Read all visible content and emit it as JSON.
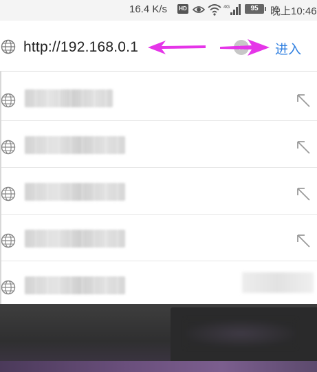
{
  "status_bar": {
    "net_speed": "16.4 K/s",
    "hd_badge": "HD",
    "battery": "95",
    "clock": "晚上10:46",
    "icons": [
      "eye-icon",
      "wifi-icon",
      "signal-icon"
    ]
  },
  "address_bar": {
    "url": "http://192.168.0.1",
    "go_label": "进入",
    "clear_icon": "×",
    "accent_color": "#2f7fe0",
    "annotation_arrow_color": "#e535e8"
  },
  "suggestions": {
    "items": [
      {
        "label": "████████████",
        "icon": "globe-icon",
        "action_icon": "arrow-up-left-icon"
      },
      {
        "label": "████████████████",
        "icon": "globe-icon",
        "action_icon": "arrow-up-left-icon"
      },
      {
        "label": "████████████████",
        "icon": "globe-icon",
        "action_icon": "arrow-up-left-icon"
      },
      {
        "label": "████████████████",
        "icon": "globe-icon",
        "action_icon": "arrow-up-left-icon"
      },
      {
        "label": "████████████████",
        "icon": "globe-icon",
        "action_icon": "arrow-up-left-icon"
      }
    ]
  }
}
